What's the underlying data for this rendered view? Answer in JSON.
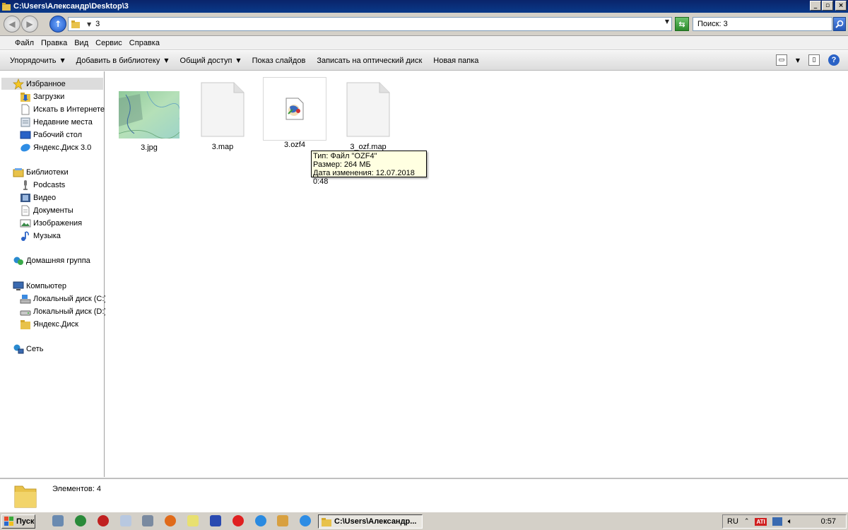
{
  "window": {
    "title": "C:\\Users\\Александр\\Desktop\\3",
    "controls": [
      "_",
      "▫",
      "×"
    ]
  },
  "address": {
    "current": "3",
    "search_text": "Поиск: 3"
  },
  "menu": [
    "Файл",
    "Правка",
    "Вид",
    "Сервис",
    "Справка"
  ],
  "commands": {
    "organize": "Упорядочить",
    "add_library": "Добавить в библиотеку",
    "share": "Общий доступ",
    "slideshow": "Показ слайдов",
    "burn": "Записать на оптический диск",
    "new_folder": "Новая папка"
  },
  "nav": {
    "favorites": "Избранное",
    "downloads": "Загрузки",
    "internet_search": "Искать в Интернете",
    "recent": "Недавние места",
    "desktop": "Рабочий стол",
    "yandex_disk_app": "Яндекс.Диск 3.0",
    "libraries": "Библиотеки",
    "podcasts": "Podcasts",
    "video": "Видео",
    "documents": "Документы",
    "pictures": "Изображения",
    "music": "Музыка",
    "homegroup": "Домашняя группа",
    "computer": "Компьютер",
    "drive_c": "Локальный диск (C:)",
    "drive_d": "Локальный диск (D:)",
    "yandex_disk": "Яндекс.Диск",
    "network": "Сеть"
  },
  "files": [
    {
      "name": "3.jpg"
    },
    {
      "name": "3.map"
    },
    {
      "name": "3.ozf4"
    },
    {
      "name": "3_ozf.map"
    }
  ],
  "tooltip": {
    "type": "Тип: Файл \"OZF4\"",
    "size": "Размер: 264 МБ",
    "modified": "Дата изменения: 12.07.2018 0:48"
  },
  "details": {
    "count": "Элементов: 4"
  },
  "taskbar": {
    "start": "Пуск",
    "active_window": "C:\\Users\\Александр...",
    "lang": "RU",
    "ati_label": "ATI",
    "clock": "0:57"
  }
}
